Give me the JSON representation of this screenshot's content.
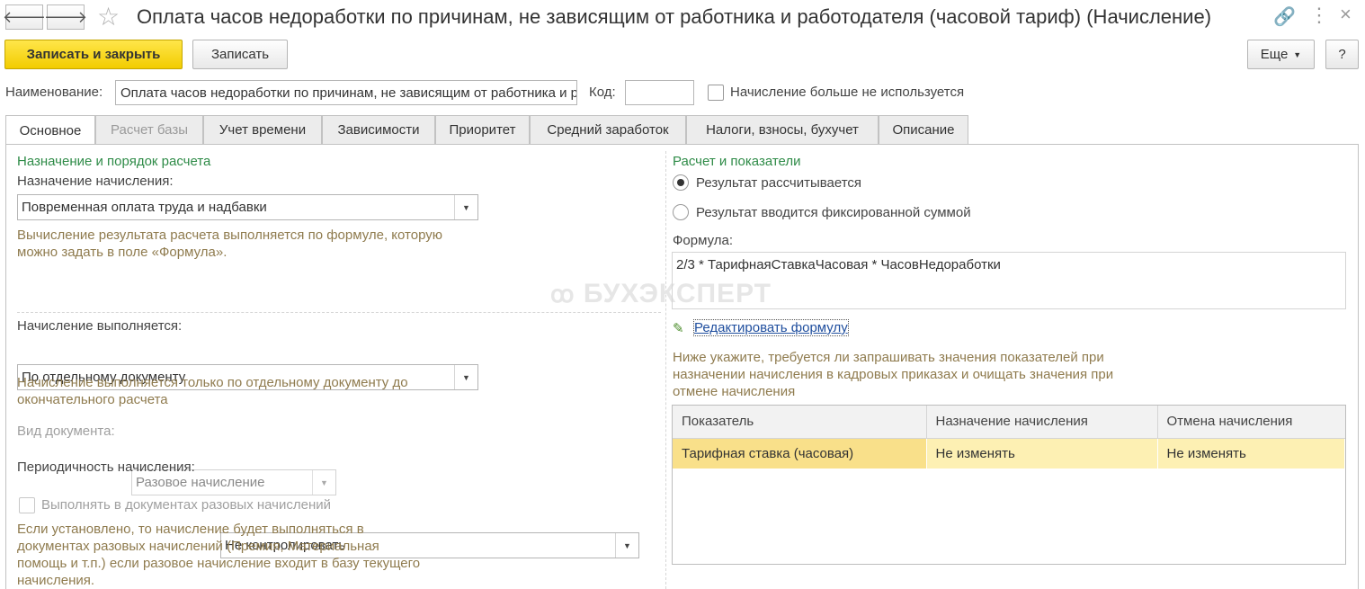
{
  "window": {
    "title": "Оплата часов недоработки по причинам, не зависящим от работника и работодателя (часовой тариф) (Начисление)"
  },
  "toolbar": {
    "save_close_label": "Записать и закрыть",
    "save_label": "Записать",
    "more_label": "Еще",
    "help_label": "?"
  },
  "header": {
    "name_label": "Наименование:",
    "name_value": "Оплата часов недоработки по причинам, не зависящим от работника и работодателя (часовой тариф)",
    "code_label": "Код:",
    "code_value": "",
    "unused_label": "Начисление больше не используется"
  },
  "tabs": [
    {
      "label": "Основное"
    },
    {
      "label": "Расчет базы"
    },
    {
      "label": "Учет времени"
    },
    {
      "label": "Зависимости"
    },
    {
      "label": "Приоритет"
    },
    {
      "label": "Средний заработок"
    },
    {
      "label": "Налоги, взносы, бухучет"
    },
    {
      "label": "Описание"
    }
  ],
  "left": {
    "section_title": "Назначение и порядок расчета",
    "purpose_label": "Назначение начисления:",
    "purpose_value": "Повременная оплата труда и надбавки",
    "purpose_hint": "Вычисление результата расчета выполняется по формуле, которую можно задать в поле «Формула».",
    "exec_label": "Начисление выполняется:",
    "exec_value": "По отдельному документу",
    "exec_hint": "Начисление выполняется только по отдельному документу до окончательного расчета",
    "doc_type_label": "Вид документа:",
    "doc_type_value": "Разовое начисление",
    "period_label": "Периодичность начисления:",
    "period_value": "Не контролировать",
    "onetime_label": "Выполнять в документах разовых начислений",
    "onetime_hint": "Если установлено, то начисление будет выполняться в документах разовых начислений (Премия, Материальная помощь и т.п.) если разовое начисление входит в базу текущего начисления."
  },
  "right": {
    "section_title": "Расчет и показатели",
    "radio_calc": "Результат рассчитывается",
    "radio_fixed": "Результат вводится фиксированной суммой",
    "formula_label": "Формула:",
    "formula_value": "2/3 * ТарифнаяСтавкаЧасовая * ЧасовНедоработки",
    "edit_formula_link": "Редактировать формулу",
    "indicators_hint": "Ниже укажите, требуется ли запрашивать значения показателей при назначении начисления в кадровых приказах и очищать значения при отмене начисления",
    "table": {
      "columns": [
        "Показатель",
        "Назначение начисления",
        "Отмена начисления"
      ],
      "rows": [
        {
          "indicator": "Тарифная ставка (часовая)",
          "assign": "Не изменять",
          "cancel": "Не изменять"
        }
      ]
    }
  },
  "watermark": "БУХЭКСПЕРТ"
}
